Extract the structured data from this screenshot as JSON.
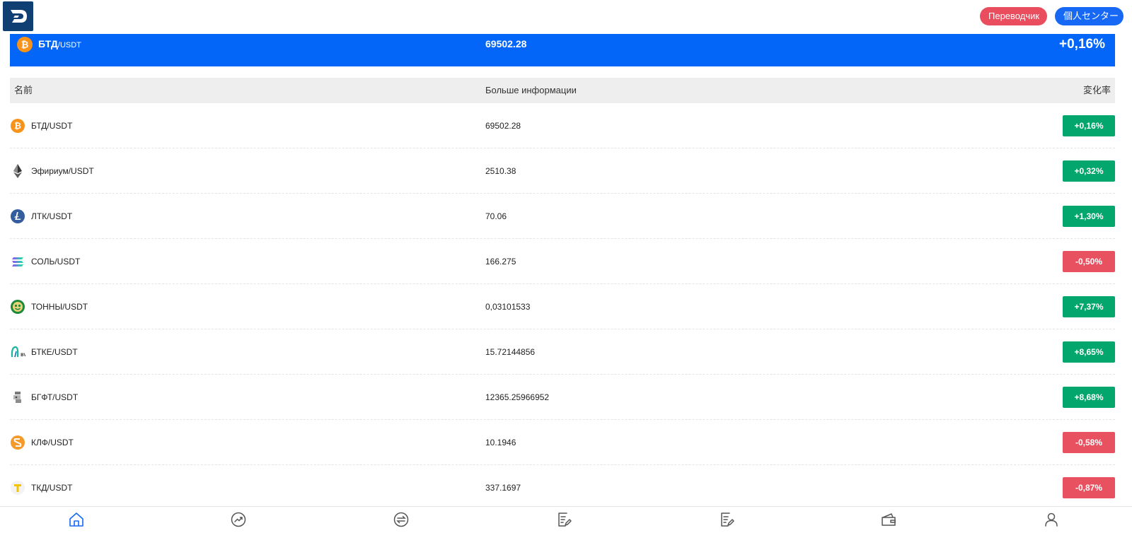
{
  "header": {
    "translator_button": "Переводчик",
    "personal_center_button": "個人センター"
  },
  "hero": {
    "pair_base": "БТД",
    "pair_quote": "/USDT",
    "price": "69502.28",
    "change": "+0,16%"
  },
  "table": {
    "columns": {
      "name": "名前",
      "info": "Больше информации",
      "rate": "変化率"
    },
    "rows": [
      {
        "pair": "БТД/USDT",
        "price": "69502.28",
        "change": "+0,16%",
        "direction": "up",
        "icon": "bitcoin-icon"
      },
      {
        "pair": "Эфириум/USDT",
        "price": "2510.38",
        "change": "+0,32%",
        "direction": "up",
        "icon": "ethereum-icon"
      },
      {
        "pair": "ЛТК/USDT",
        "price": "70.06",
        "change": "+1,30%",
        "direction": "up",
        "icon": "litecoin-icon"
      },
      {
        "pair": "СОЛЬ/USDT",
        "price": "166.275",
        "change": "-0,50%",
        "direction": "down",
        "icon": "solana-icon"
      },
      {
        "pair": "ТОННЫ/USDT",
        "price": "0,03101533",
        "change": "+7,37%",
        "direction": "up",
        "icon": "tonny-icon"
      },
      {
        "pair": "БТКЕ/USDT",
        "price": "15.72144856",
        "change": "+8,65%",
        "direction": "up",
        "icon": "btke-icon"
      },
      {
        "pair": "БГФТ/USDT",
        "price": "12365.25966952",
        "change": "+8,68%",
        "direction": "up",
        "icon": "bgft-icon"
      },
      {
        "pair": "КЛФ/USDT",
        "price": "10.1946",
        "change": "-0,58%",
        "direction": "down",
        "icon": "klf-icon"
      },
      {
        "pair": "ТКД/USDT",
        "price": "337.1697",
        "change": "-0,87%",
        "direction": "down",
        "icon": "tkd-icon"
      }
    ]
  },
  "colors": {
    "accent": "#0366f8",
    "up": "#03a66d",
    "down": "#e8515f",
    "active_tab": "#1668f5",
    "inactive_tab": "#555555"
  },
  "tabbar": {
    "tabs": [
      {
        "icon": "home-icon",
        "active": true
      },
      {
        "icon": "trend-icon",
        "active": false
      },
      {
        "icon": "exchange-icon",
        "active": false
      },
      {
        "icon": "document-edit-icon",
        "active": false
      },
      {
        "icon": "document-edit-icon",
        "active": false
      },
      {
        "icon": "wallet-icon",
        "active": false
      },
      {
        "icon": "user-icon",
        "active": false
      }
    ]
  }
}
